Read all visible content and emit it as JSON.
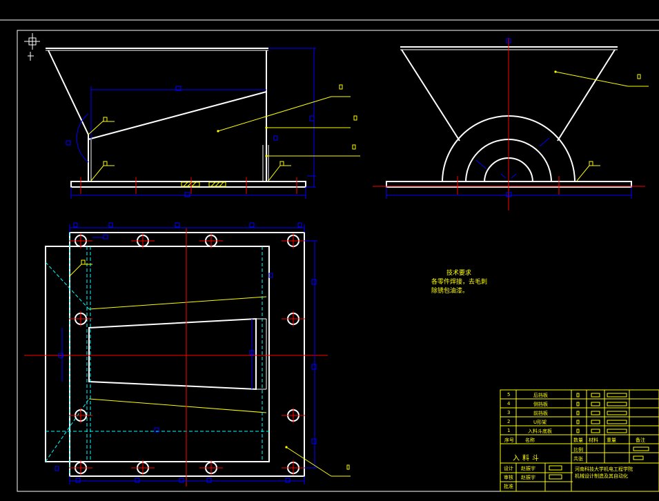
{
  "tech_requirements": {
    "title": "技术要求",
    "line1": "各零件焊接，去毛刺",
    "line2": "除锈包油漆。"
  },
  "parts_list": [
    {
      "no": "5",
      "name": "后挡板"
    },
    {
      "no": "4",
      "name": "侧挡板"
    },
    {
      "no": "3",
      "name": "前挡板"
    },
    {
      "no": "2",
      "name": "U形架"
    },
    {
      "no": "1",
      "name": "入料斗底板"
    }
  ],
  "parts_header": {
    "seq": "序号",
    "name": "名称",
    "qty": "数量",
    "material": "材料",
    "weight": "重量",
    "remark": "备注"
  },
  "title_block": {
    "drawing_name": "入料斗",
    "designer_label": "设计",
    "designer": "赵振宇",
    "checker_label": "审核",
    "checker": "赵振宇",
    "approver_label": "批准",
    "scale_label": "比例",
    "sheet_label": "共张",
    "school_line1": "河南科技大学机电工程学院",
    "school_line2": "机械设计制造及其自动化"
  },
  "colors": {
    "background": "#000000",
    "outline": "#ffffff",
    "dimension": "#0000ff",
    "centerline": "#ff0000",
    "hidden": "#00ffff",
    "leader": "#ffff00"
  }
}
